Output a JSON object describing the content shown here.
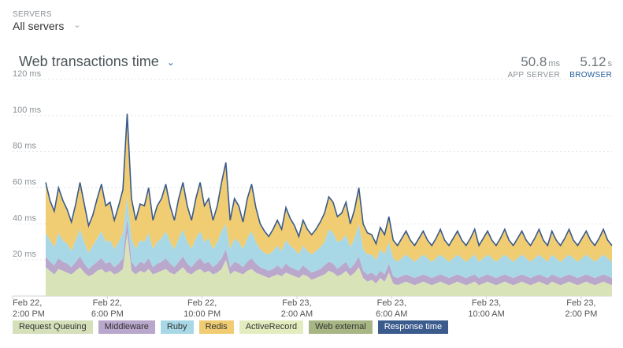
{
  "servers": {
    "label": "SERVERS",
    "value": "All servers"
  },
  "title": "Web transactions time",
  "metrics": {
    "app_server": {
      "value": "50.8",
      "unit": "ms",
      "label": "APP SERVER"
    },
    "browser": {
      "value": "5.12",
      "unit": "s",
      "label": "BROWSER"
    }
  },
  "legend": [
    {
      "name": "Request Queuing",
      "color": "#d5dfba"
    },
    {
      "name": "Middleware",
      "color": "#b9a7cc"
    },
    {
      "name": "Ruby",
      "color": "#a8d8e6"
    },
    {
      "name": "Redis",
      "color": "#f0cd72"
    },
    {
      "name": "ActiveRecord",
      "color": "#e3ecbf"
    },
    {
      "name": "Web external",
      "color": "#a7b684"
    },
    {
      "name": "Response time",
      "color": "#3a5b8c"
    }
  ],
  "chart_data": {
    "type": "area",
    "stacked": true,
    "ylim": [
      0,
      120
    ],
    "y_ticks": [
      {
        "value": 20,
        "label": "20 ms"
      },
      {
        "value": 40,
        "label": "40 ms"
      },
      {
        "value": 60,
        "label": "60 ms"
      },
      {
        "value": 80,
        "label": "80 ms"
      },
      {
        "value": 100,
        "label": "100 ms"
      },
      {
        "value": 120,
        "label": "120 ms"
      }
    ],
    "x_ticks": [
      {
        "hours": 0,
        "line1": "Feb 22,",
        "line2": "2:00 PM"
      },
      {
        "hours": 4,
        "line1": "Feb 22,",
        "line2": "6:00 PM"
      },
      {
        "hours": 8,
        "line1": "Feb 22,",
        "line2": "10:00 PM"
      },
      {
        "hours": 12,
        "line1": "Feb 23,",
        "line2": "2:00 AM"
      },
      {
        "hours": 16,
        "line1": "Feb 23,",
        "line2": "6:00 AM"
      },
      {
        "hours": 20,
        "line1": "Feb 23,",
        "line2": "10:00 AM"
      },
      {
        "hours": 24,
        "line1": "Feb 23,",
        "line2": "2:00 PM"
      }
    ],
    "x_range_hours": [
      0,
      25.3
    ],
    "grid": true,
    "legend_position": "bottom",
    "series": [
      {
        "name": "ActiveRecord",
        "color": "#d8e4b8",
        "values": [
          16,
          14,
          12,
          15,
          14,
          13,
          12,
          14,
          16,
          13,
          11,
          12,
          14,
          15,
          13,
          14,
          12,
          13,
          15,
          35,
          14,
          12,
          14,
          13,
          15,
          12,
          13,
          14,
          15,
          13,
          12,
          14,
          16,
          13,
          12,
          14,
          15,
          13,
          14,
          12,
          13,
          15,
          20,
          12,
          14,
          13,
          12,
          14,
          15,
          13,
          12,
          11,
          10,
          11,
          12,
          11,
          13,
          12,
          11,
          10,
          12,
          11,
          9,
          10,
          11,
          12,
          14,
          13,
          11,
          12,
          14,
          11,
          13,
          16,
          10,
          8,
          9,
          7,
          10,
          8,
          13,
          7,
          6,
          7,
          8,
          7,
          6,
          7,
          8,
          7,
          6,
          7,
          8,
          7,
          6,
          7,
          8,
          7,
          6,
          7,
          8,
          6,
          7,
          8,
          7,
          6,
          7,
          8,
          7,
          6,
          7,
          8,
          7,
          6,
          7,
          8,
          7,
          6,
          8,
          7,
          6,
          7,
          8,
          7,
          6,
          7,
          8,
          7,
          6,
          7,
          8,
          7,
          6
        ]
      },
      {
        "name": "Middleware",
        "color": "#b9a7cc",
        "values": [
          6,
          5,
          5,
          6,
          5,
          5,
          4,
          5,
          6,
          5,
          4,
          5,
          5,
          6,
          5,
          5,
          4,
          5,
          6,
          8,
          5,
          4,
          5,
          5,
          6,
          4,
          5,
          5,
          6,
          5,
          4,
          5,
          6,
          5,
          4,
          5,
          6,
          5,
          5,
          4,
          5,
          6,
          6,
          4,
          5,
          5,
          4,
          5,
          6,
          5,
          4,
          4,
          4,
          4,
          5,
          4,
          5,
          4,
          4,
          4,
          5,
          4,
          4,
          4,
          4,
          5,
          5,
          5,
          4,
          5,
          5,
          4,
          5,
          6,
          4,
          4,
          4,
          4,
          4,
          4,
          5,
          4,
          4,
          4,
          4,
          4,
          4,
          4,
          4,
          4,
          4,
          4,
          4,
          4,
          4,
          4,
          4,
          4,
          4,
          4,
          4,
          4,
          4,
          4,
          4,
          4,
          4,
          4,
          4,
          4,
          4,
          4,
          4,
          4,
          4,
          4,
          4,
          4,
          4,
          4,
          4,
          4,
          4,
          4,
          4,
          4,
          4,
          4,
          4,
          4,
          4,
          4,
          4
        ]
      },
      {
        "name": "Ruby",
        "color": "#a8d8e6",
        "values": [
          13,
          12,
          10,
          14,
          12,
          11,
          9,
          12,
          15,
          12,
          9,
          11,
          13,
          15,
          12,
          12,
          10,
          12,
          14,
          12,
          13,
          10,
          12,
          12,
          14,
          10,
          12,
          13,
          15,
          12,
          10,
          13,
          15,
          12,
          10,
          13,
          15,
          12,
          13,
          10,
          12,
          15,
          14,
          10,
          13,
          12,
          10,
          13,
          15,
          12,
          10,
          9,
          9,
          10,
          11,
          10,
          13,
          12,
          11,
          9,
          11,
          10,
          10,
          11,
          12,
          13,
          18,
          17,
          15,
          14,
          15,
          12,
          14,
          18,
          12,
          11,
          10,
          9,
          12,
          11,
          12,
          10,
          9,
          10,
          11,
          10,
          9,
          10,
          11,
          10,
          9,
          10,
          11,
          10,
          9,
          10,
          11,
          10,
          9,
          10,
          11,
          9,
          10,
          11,
          10,
          9,
          10,
          11,
          10,
          9,
          10,
          11,
          10,
          9,
          10,
          11,
          10,
          9,
          11,
          10,
          9,
          10,
          11,
          10,
          9,
          10,
          11,
          10,
          9,
          10,
          11,
          10,
          9
        ]
      },
      {
        "name": "Redis",
        "color": "#f0cd72",
        "values": [
          28,
          22,
          20,
          25,
          22,
          19,
          16,
          20,
          26,
          21,
          15,
          17,
          22,
          26,
          20,
          21,
          16,
          20,
          24,
          46,
          22,
          16,
          20,
          20,
          25,
          16,
          20,
          22,
          26,
          20,
          16,
          22,
          26,
          20,
          16,
          22,
          27,
          20,
          22,
          16,
          20,
          27,
          34,
          16,
          22,
          20,
          15,
          22,
          26,
          19,
          14,
          12,
          10,
          12,
          14,
          12,
          18,
          15,
          13,
          10,
          14,
          12,
          11,
          12,
          14,
          16,
          18,
          17,
          14,
          15,
          18,
          13,
          16,
          20,
          14,
          12,
          11,
          9,
          12,
          11,
          14,
          10,
          9,
          11,
          13,
          10,
          9,
          11,
          13,
          10,
          9,
          11,
          14,
          10,
          9,
          11,
          13,
          10,
          9,
          11,
          14,
          9,
          11,
          13,
          10,
          9,
          11,
          14,
          10,
          9,
          11,
          13,
          10,
          9,
          11,
          14,
          10,
          9,
          13,
          10,
          9,
          11,
          14,
          10,
          9,
          11,
          13,
          10,
          9,
          11,
          14,
          10,
          9
        ]
      },
      {
        "name": "Response time",
        "color": "#3a5b8c",
        "values": [
          63,
          53,
          47,
          60,
          53,
          48,
          41,
          51,
          63,
          51,
          39,
          45,
          54,
          62,
          50,
          52,
          42,
          50,
          59,
          101,
          54,
          42,
          51,
          50,
          60,
          42,
          50,
          54,
          62,
          50,
          42,
          54,
          63,
          50,
          42,
          54,
          63,
          50,
          54,
          42,
          50,
          63,
          74,
          42,
          54,
          50,
          41,
          54,
          62,
          49,
          40,
          36,
          33,
          37,
          42,
          37,
          49,
          43,
          39,
          33,
          42,
          37,
          34,
          37,
          41,
          46,
          55,
          52,
          44,
          46,
          52,
          40,
          48,
          60,
          40,
          35,
          34,
          29,
          38,
          34,
          44,
          31,
          28,
          32,
          36,
          31,
          28,
          32,
          36,
          31,
          28,
          32,
          37,
          31,
          28,
          32,
          36,
          31,
          28,
          32,
          37,
          28,
          32,
          36,
          31,
          28,
          32,
          37,
          31,
          28,
          32,
          36,
          31,
          28,
          32,
          37,
          31,
          28,
          36,
          31,
          28,
          32,
          37,
          31,
          28,
          32,
          36,
          31,
          28,
          32,
          37,
          31,
          28
        ]
      }
    ]
  }
}
